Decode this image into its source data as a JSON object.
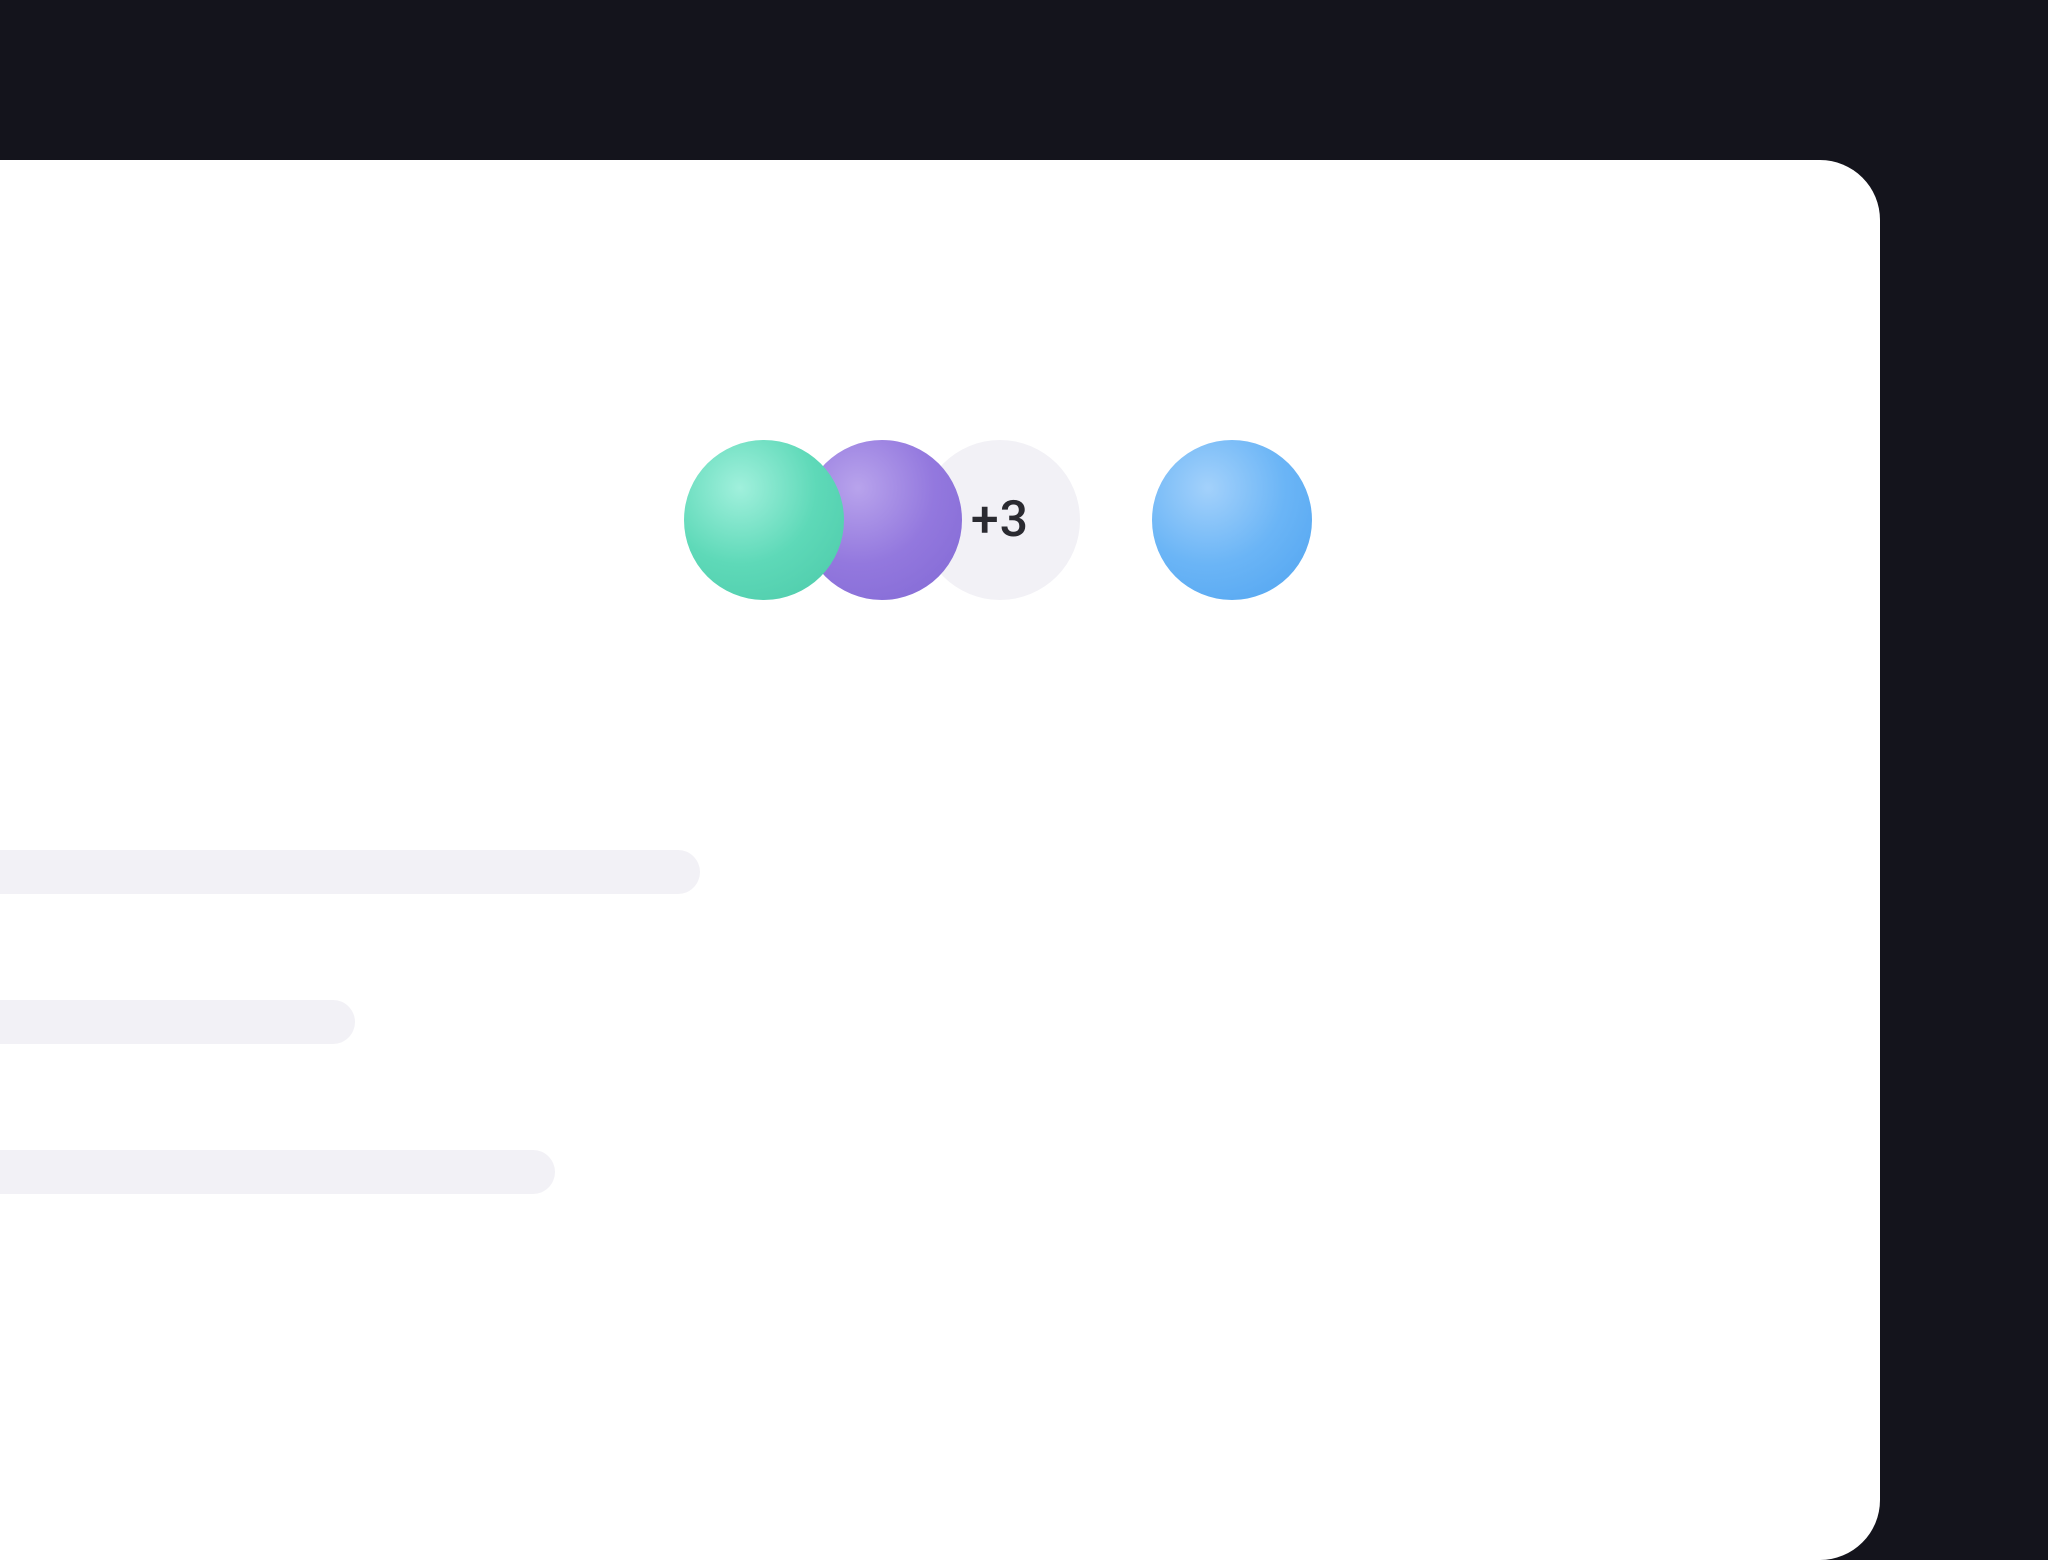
{
  "avatars": {
    "items": [
      {
        "name": "avatar-teal"
      },
      {
        "name": "avatar-purple"
      }
    ],
    "overflow_label": "+3",
    "separate": {
      "name": "avatar-blue"
    }
  }
}
